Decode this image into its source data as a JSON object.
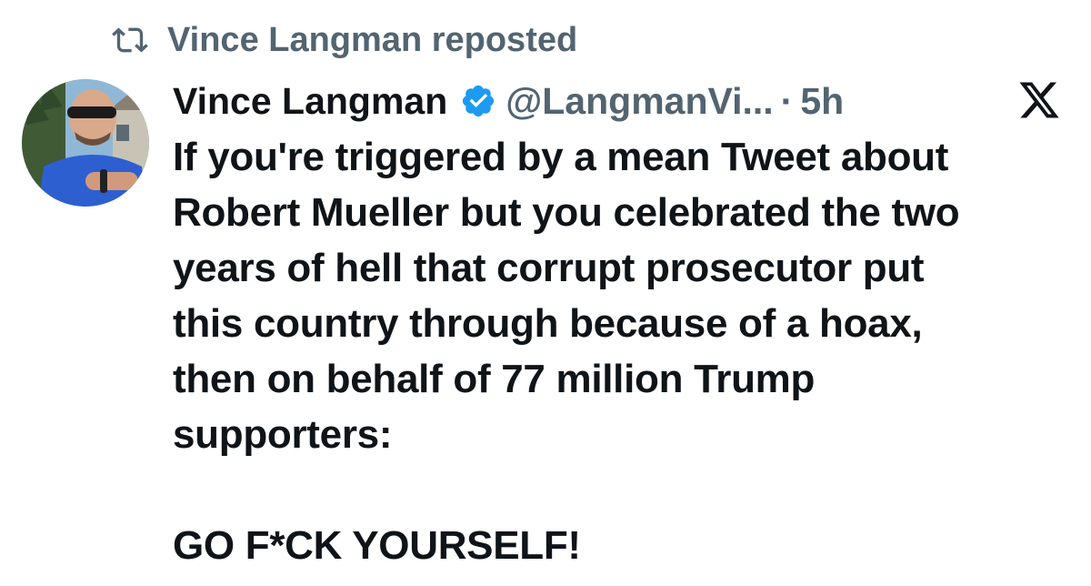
{
  "repost": {
    "icon": "repost-icon",
    "label": "Vince Langman reposted"
  },
  "tweet": {
    "author_name": "Vince Langman",
    "verified_icon": "verified-badge-icon",
    "handle": "@LangmanVi...",
    "separator": "·",
    "time": "5h",
    "platform_icon": "x-logo-icon",
    "body_lines": [
      "If you're triggered by a mean Tweet about",
      "Robert Mueller but you celebrated the two",
      "years of hell that corrupt prosecutor put",
      "this country through because of a hoax,",
      "then on behalf of 77 million Trump",
      "supporters:"
    ],
    "closing": "GO F*CK YOURSELF!"
  },
  "colors": {
    "text_primary": "#0f1419",
    "text_secondary": "#536471",
    "verified_blue": "#1d9bf0"
  }
}
